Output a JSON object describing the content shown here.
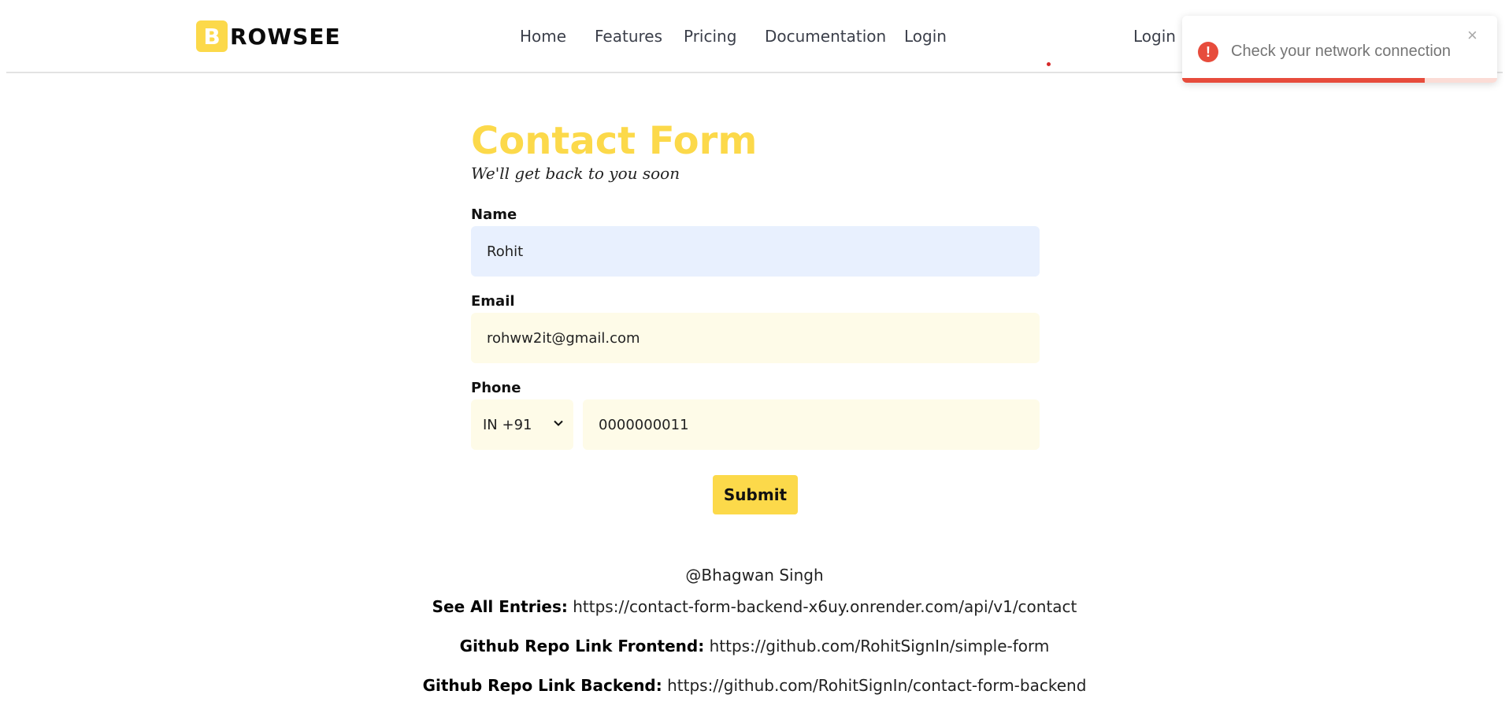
{
  "brand": {
    "logo_letter": "B",
    "logo_text": "ROWSEE",
    "accent_color": "#fcd94a"
  },
  "nav": {
    "items": [
      "Home",
      "Features",
      "Pricing",
      "Documentation",
      "Login"
    ],
    "right_login": "Login"
  },
  "toast": {
    "icon": "error-icon",
    "message": "Check your network connection",
    "close_glyph": "×",
    "progress_fraction": 0.77,
    "color": "#e74c3c"
  },
  "form": {
    "title": "Contact Form",
    "subtitle": "We'll get back to you soon",
    "name_label": "Name",
    "name_value": "Rohit",
    "email_label": "Email",
    "email_value": "rohww2it@gmail.com",
    "phone_label": "Phone",
    "country_code": "IN +91",
    "phone_value": "0000000011",
    "submit_label": "Submit"
  },
  "footer": {
    "author": "@Bhagwan Singh",
    "entries_label": "See All Entries:",
    "entries_link": "https://contact-form-backend-x6uy.onrender.com/api/v1/contact",
    "frontend_label": "Github Repo Link Frontend:",
    "frontend_link": "https://github.com/RohitSignIn/simple-form",
    "backend_label": "Github Repo Link Backend:",
    "backend_link": "https://github.com/RohitSignIn/contact-form-backend"
  }
}
